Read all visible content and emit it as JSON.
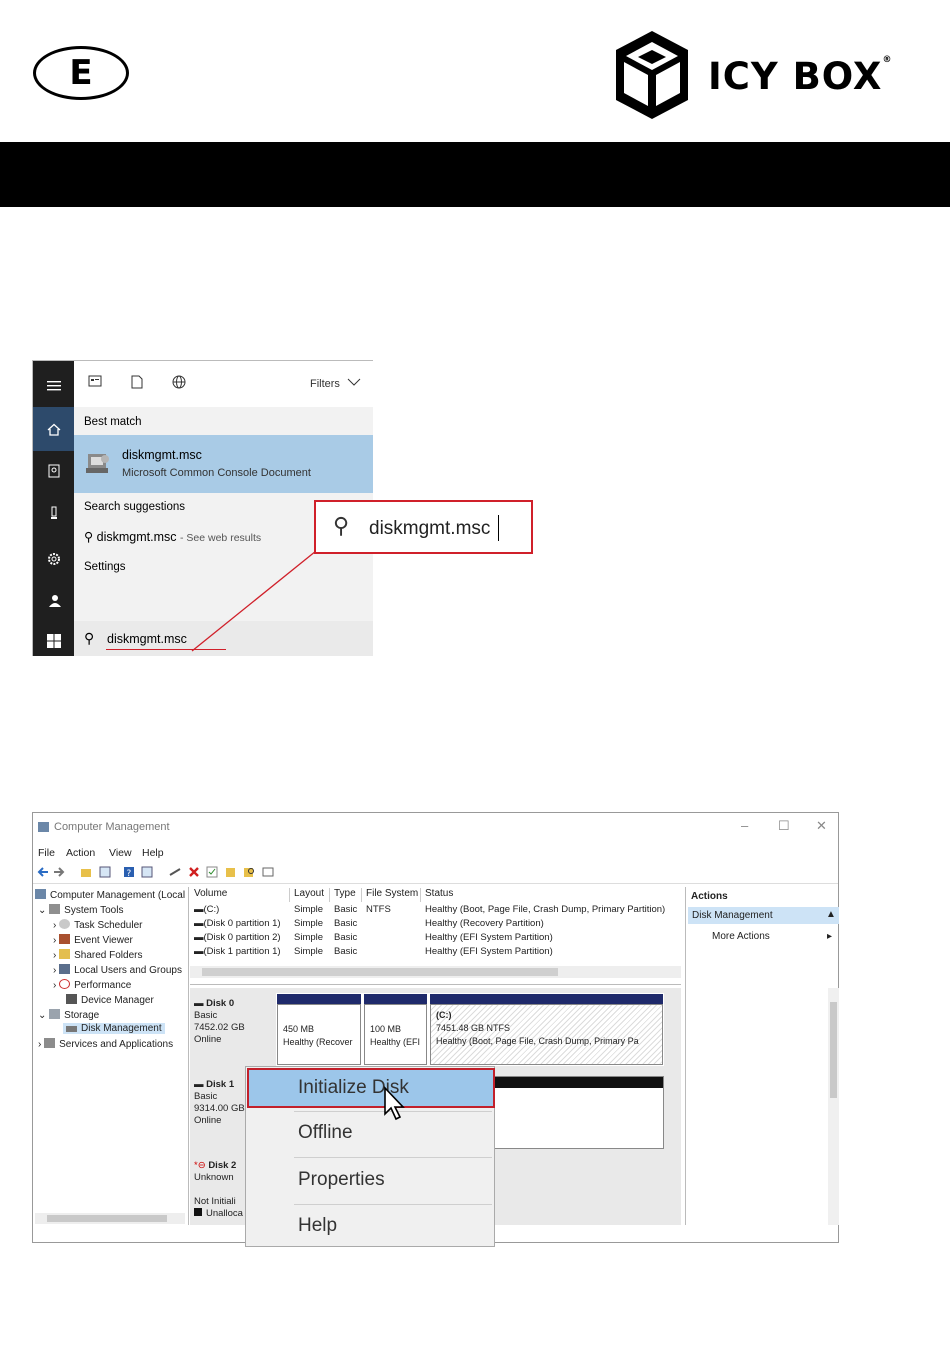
{
  "header": {
    "language_code": "E",
    "brand_name": "ICY BOX",
    "brand_mark": "®"
  },
  "search_screenshot": {
    "filters_label": "Filters",
    "best_match_label": "Best match",
    "result_title": "diskmgmt.msc",
    "result_subtitle": "Microsoft Common Console Document",
    "search_suggestions_label": "Search suggestions",
    "suggestion_query": "diskmgmt.msc",
    "suggestion_suffix": "- See web results",
    "settings_label": "Settings",
    "query": "diskmgmt.msc",
    "zoom_query": "diskmgmt.msc",
    "icons": [
      "hamburger-icon",
      "home-icon",
      "documents-icon",
      "bulb-icon",
      "settings-icon",
      "people-icon",
      "windows-icon",
      "apps-icon",
      "document-icon",
      "globe-icon",
      "search-icon"
    ]
  },
  "computer_management": {
    "window_title": "Computer Management",
    "window_controls": [
      "–",
      "☐",
      "✕"
    ],
    "menu": [
      "File",
      "Action",
      "View",
      "Help"
    ],
    "tree": {
      "root": "Computer Management (Local",
      "system_tools": "System Tools",
      "task_scheduler": "Task Scheduler",
      "event_viewer": "Event Viewer",
      "shared_folders": "Shared Folders",
      "local_users": "Local Users and Groups",
      "performance": "Performance",
      "device_manager": "Device Manager",
      "storage": "Storage",
      "disk_management": "Disk Management",
      "services": "Services and Applications"
    },
    "volume_columns": [
      "Volume",
      "Layout",
      "Type",
      "File System",
      "Status"
    ],
    "volumes": [
      {
        "volume": "(C:)",
        "layout": "Simple",
        "type": "Basic",
        "fs": "NTFS",
        "status": "Healthy (Boot, Page File, Crash Dump, Primary Partition)"
      },
      {
        "volume": "(Disk 0 partition 1)",
        "layout": "Simple",
        "type": "Basic",
        "fs": "",
        "status": "Healthy (Recovery Partition)"
      },
      {
        "volume": "(Disk 0 partition 2)",
        "layout": "Simple",
        "type": "Basic",
        "fs": "",
        "status": "Healthy (EFI System Partition)"
      },
      {
        "volume": "(Disk 1 partition 1)",
        "layout": "Simple",
        "type": "Basic",
        "fs": "",
        "status": "Healthy (EFI System Partition)"
      }
    ],
    "disk0": {
      "name": "Disk 0",
      "type": "Basic",
      "size": "7452.02 GB",
      "state": "Online",
      "p1_size": "450 MB",
      "p1_status": "Healthy (Recover",
      "p2_size": "100 MB",
      "p2_status": "Healthy (EFI",
      "p3_name": "(C:)",
      "p3_size": "7451.48 GB NTFS",
      "p3_status": "Healthy (Boot, Page File, Crash Dump, Primary Pa"
    },
    "disk1": {
      "name": "Disk 1",
      "type": "Basic",
      "size": "9314.00 GB",
      "state": "Online"
    },
    "disk2": {
      "name": "Disk 2",
      "type": "Unknown",
      "state": "Not Initiali",
      "legend": "Unalloca"
    },
    "actions": {
      "header": "Actions",
      "selected": "Disk Management",
      "more": "More Actions"
    },
    "context_menu": [
      "Initialize Disk",
      "Offline",
      "Properties",
      "Help"
    ]
  }
}
